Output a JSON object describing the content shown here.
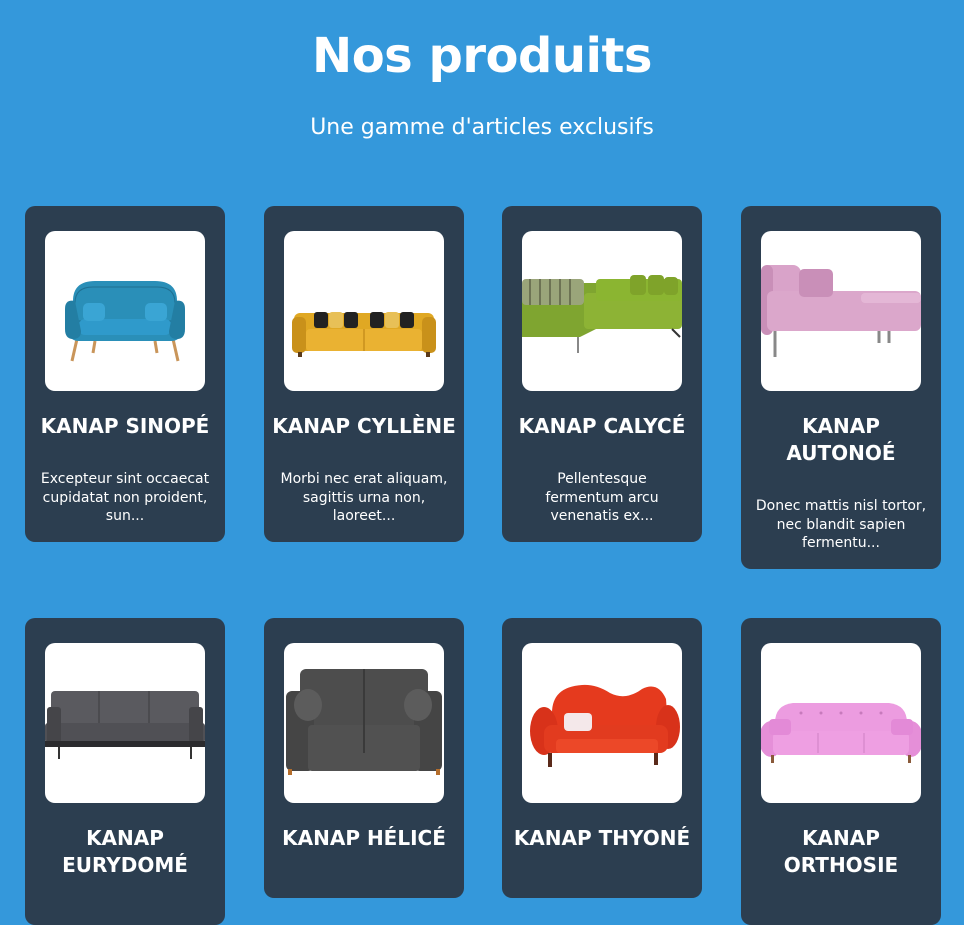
{
  "header": {
    "title": "Nos produits",
    "subtitle": "Une gamme d'articles exclusifs"
  },
  "products": [
    {
      "name": "KANAP SINOPÉ",
      "description": "Excepteur sint occaecat cupidatat non proident, sun...",
      "color": "#2a8fb8",
      "style": "round"
    },
    {
      "name": "KANAP CYLLÈNE",
      "description": "Morbi nec erat aliquam, sagittis urna non, laoreet...",
      "color": "#e0a823",
      "style": "long"
    },
    {
      "name": "KANAP CALYCÉ",
      "description": "Pellentesque fermentum arcu venenatis ex...",
      "color": "#8db335",
      "style": "corner"
    },
    {
      "name": "KANAP AUTONOÉ",
      "description": "Donec mattis nisl tortor, nec blandit sapien fermentu...",
      "color": "#d9a3c9",
      "style": "daybed"
    },
    {
      "name": "KANAP EURYDOMÉ",
      "description": "",
      "color": "#5a5a5f",
      "style": "modern"
    },
    {
      "name": "KANAP HÉLICÉ",
      "description": "",
      "color": "#4d4d4d",
      "style": "boxy"
    },
    {
      "name": "KANAP THYONÉ",
      "description": "",
      "color": "#e53a1e",
      "style": "camel"
    },
    {
      "name": "KANAP ORTHOSIE",
      "description": "",
      "color": "#ec9ce0",
      "style": "tufted"
    }
  ]
}
